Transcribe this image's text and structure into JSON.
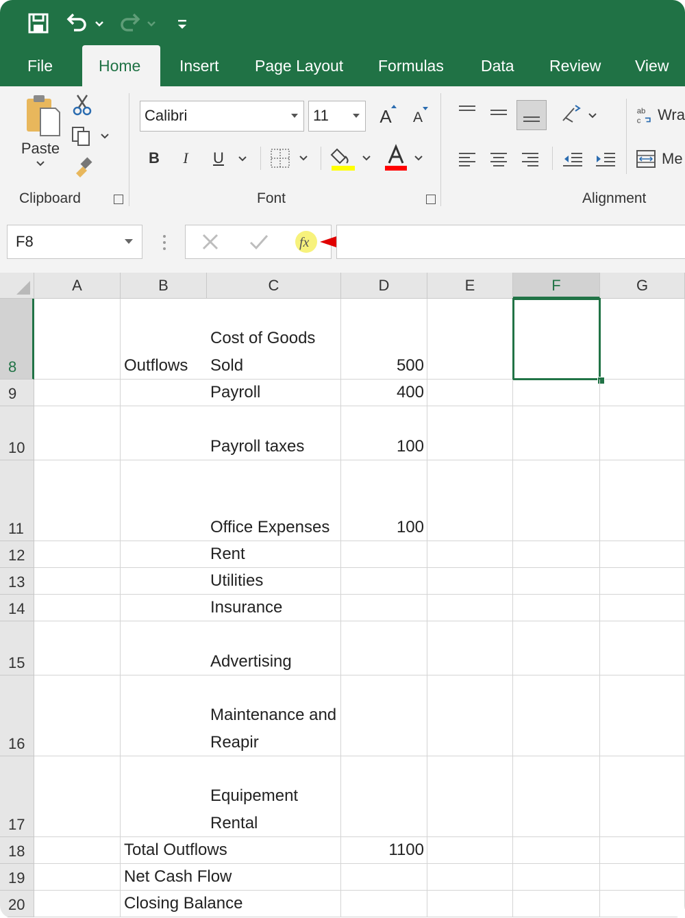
{
  "tabs": [
    "File",
    "Home",
    "Insert",
    "Page Layout",
    "Formulas",
    "Data",
    "Review",
    "View"
  ],
  "active_tab": "Home",
  "ribbon": {
    "clipboard": {
      "label": "Clipboard",
      "paste": "Paste"
    },
    "font": {
      "label": "Font",
      "name": "Calibri",
      "size": "11",
      "bold": "B",
      "italic": "I",
      "underline": "U",
      "grow": "A",
      "shrink": "A"
    },
    "alignment": {
      "label": "Alignment",
      "wrap": "Wra",
      "merge": "Me"
    }
  },
  "formula_bar": {
    "name_box": "F8",
    "formula": ""
  },
  "colors": {
    "excel_green": "#207245",
    "fill_yellow": "#ffff00",
    "font_red": "#ff0000",
    "arrow_red": "#e00000"
  },
  "columns": [
    "A",
    "B",
    "C",
    "D",
    "E",
    "F",
    "G"
  ],
  "selected_cell": "F8",
  "rows": [
    {
      "num": "8",
      "B": "Outflows",
      "C": "Cost of Goods Sold",
      "D": "500"
    },
    {
      "num": "9",
      "B": "",
      "C": "Payroll",
      "D": "400"
    },
    {
      "num": "10",
      "B": "",
      "C": "Payroll taxes",
      "D": "100"
    },
    {
      "num": "11",
      "B": "",
      "C": "Office Expenses",
      "D": "100"
    },
    {
      "num": "12",
      "B": "",
      "C": "Rent",
      "D": ""
    },
    {
      "num": "13",
      "B": "",
      "C": "Utilities",
      "D": ""
    },
    {
      "num": "14",
      "B": "",
      "C": "Insurance",
      "D": ""
    },
    {
      "num": "15",
      "B": "",
      "C": "Advertising",
      "D": ""
    },
    {
      "num": "16",
      "B": "",
      "C": "Maintenance and Reapir",
      "D": ""
    },
    {
      "num": "17",
      "B": "",
      "C": "Equipement Rental",
      "D": ""
    },
    {
      "num": "18",
      "B": "Total Outflows",
      "C": "",
      "D": "1100"
    },
    {
      "num": "19",
      "B": "Net Cash Flow",
      "C": "",
      "D": ""
    },
    {
      "num": "20",
      "B": "Closing Balance",
      "C": "",
      "D": ""
    }
  ]
}
